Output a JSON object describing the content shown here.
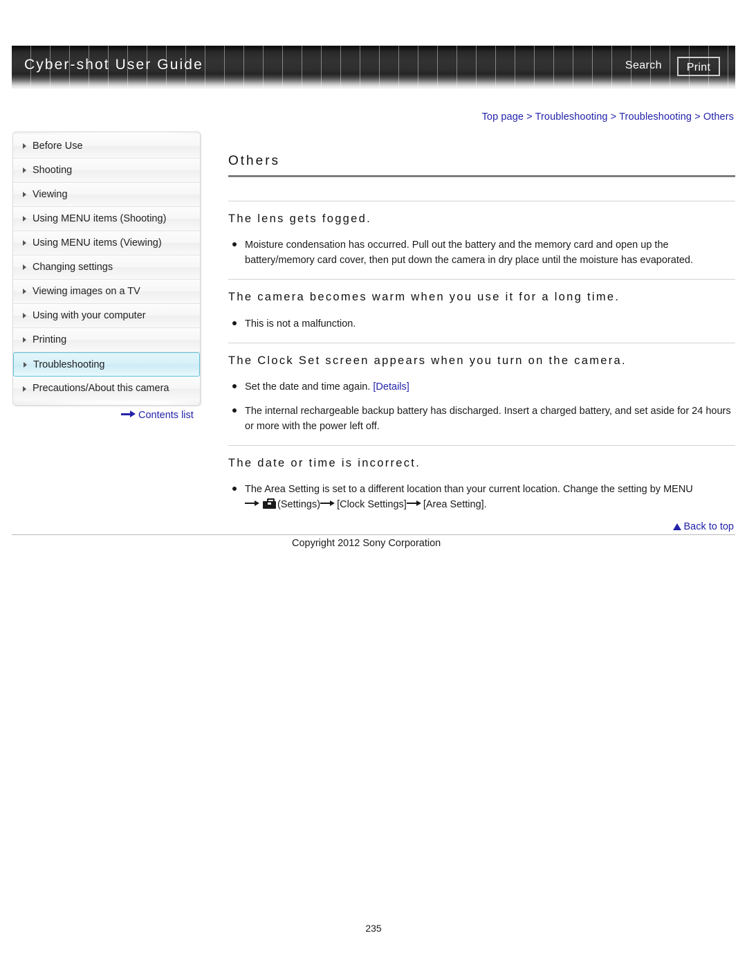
{
  "header": {
    "title": "Cyber-shot User Guide",
    "search_label": "Search",
    "print_label": "Print"
  },
  "breadcrumb": {
    "text": "Top page > Troubleshooting > Troubleshooting > Others"
  },
  "sidebar": {
    "items": [
      {
        "label": "Before Use",
        "selected": false
      },
      {
        "label": "Shooting",
        "selected": false
      },
      {
        "label": "Viewing",
        "selected": false
      },
      {
        "label": "Using MENU items (Shooting)",
        "selected": false
      },
      {
        "label": "Using MENU items (Viewing)",
        "selected": false
      },
      {
        "label": "Changing settings",
        "selected": false
      },
      {
        "label": "Viewing images on a TV",
        "selected": false
      },
      {
        "label": "Using with your computer",
        "selected": false
      },
      {
        "label": "Printing",
        "selected": false
      },
      {
        "label": "Troubleshooting",
        "selected": true
      },
      {
        "label": "Precautions/About this camera",
        "selected": false
      }
    ],
    "contents_list_label": "Contents list"
  },
  "main": {
    "page_title": "Others",
    "sections": [
      {
        "title": "The lens gets fogged.",
        "bullets": [
          "Moisture condensation has occurred. Pull out the battery and the memory card and open up the battery/memory card cover, then put down the camera in dry place until the moisture has evaporated."
        ]
      },
      {
        "title": "The camera becomes warm when you use it for a long time.",
        "bullets": [
          "This is not a malfunction."
        ]
      },
      {
        "title": "The Clock Set screen appears when you turn on the camera.",
        "bullets": [
          "Set the date and time again. [Details]",
          "The internal rechargeable backup battery has discharged. Insert a charged battery, and set aside for 24 hours or more with the power left off."
        ]
      },
      {
        "title": "The date or time is incorrect.",
        "bullets": [
          "The Area Setting is set to a different location than your current location. Change the setting by MENU"
        ]
      }
    ],
    "details_link_text": "[Details]",
    "set_date_prefix": "Set the date and time again. ",
    "area_setting_path": {
      "settings_label": "(Settings)",
      "clock_settings_label": "[Clock Settings]",
      "area_setting_label": "[Area Setting]."
    }
  },
  "footer": {
    "back_to_top_label": "Back to top",
    "copyright": "Copyright 2012 Sony Corporation",
    "page_number": "235"
  },
  "colors": {
    "link": "#2222aa",
    "selected_nav_bg": "#d6f0f8",
    "selected_nav_border": "#5fc2d8"
  }
}
